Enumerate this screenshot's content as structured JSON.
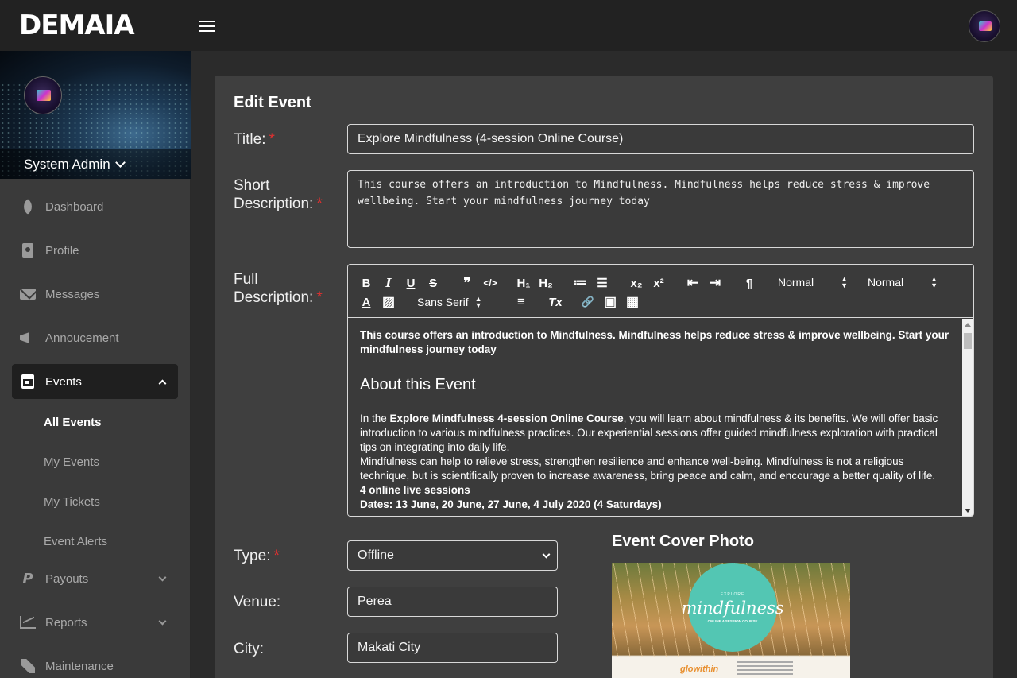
{
  "header": {
    "logo_text": "DEMAIA",
    "menu_icon": "hamburger-icon",
    "avatar_icon": "avatar"
  },
  "sidebar": {
    "user_name": "System Admin",
    "items": [
      {
        "label": "Dashboard",
        "icon": "rocket-icon"
      },
      {
        "label": "Profile",
        "icon": "id-badge-icon"
      },
      {
        "label": "Messages",
        "icon": "envelope-icon"
      },
      {
        "label": "Annoucement",
        "icon": "megaphone-icon"
      },
      {
        "label": "Events",
        "icon": "calendar-icon",
        "active": true
      },
      {
        "label": "Payouts",
        "icon": "paypal-icon"
      },
      {
        "label": "Reports",
        "icon": "chart-icon"
      },
      {
        "label": "Maintenance",
        "icon": "tools-icon"
      }
    ],
    "events_sub": [
      "All Events",
      "My Events",
      "My Tickets",
      "Event Alerts"
    ]
  },
  "form": {
    "heading": "Edit Event",
    "title_label": "Title:",
    "title_value": "Explore Mindfulness (4-session Online Course)",
    "short_desc_label_1": "Short",
    "short_desc_label_2": "Description:",
    "short_desc_value": "This course offers an introduction to Mindfulness. Mindfulness helps reduce stress & improve wellbeing. Start your mindfulness journey today",
    "full_desc_label_1": "Full",
    "full_desc_label_2": "Description:",
    "required_mark": "*",
    "type_label": "Type:",
    "type_value": "Offline",
    "venue_label": "Venue:",
    "venue_value": "Perea",
    "city_label": "City:",
    "city_value": "Makati City"
  },
  "editor": {
    "toolbar": {
      "bold": "B",
      "italic": "I",
      "underline": "U",
      "strike": "S",
      "quote": "❞",
      "code": "</>",
      "h1": "H₁",
      "h2": "H₂",
      "ordered_list": "≔",
      "bullet_list": "☰",
      "subscript": "x₂",
      "superscript": "x²",
      "outdent": "⇤",
      "indent": "⇥",
      "direction": "¶",
      "size_select": "Normal",
      "header_select": "Normal",
      "font_select": "Sans Serif",
      "color": "A",
      "background": "▨",
      "align": "≡",
      "clean": "Tx",
      "link": "🔗",
      "image": "▣",
      "video": "▦"
    },
    "content": {
      "intro": "This course offers an introduction to Mindfulness. Mindfulness helps reduce stress & improve wellbeing. Start your mindfulness journey today",
      "heading": "About this Event",
      "p1_prefix": "In the ",
      "p1_bold": "Explore Mindfulness 4-session Online Course",
      "p1_rest": ", you will learn about mindfulness & its benefits. We will offer basic introduction to various mindfulness practices. Our experiential sessions offer guided mindfulness exploration with practical tips on integrating into daily life.",
      "p2": "Mindfulness can help to relieve stress, strengthen resilience and enhance well-being. Mindfulness is not a religious technique, but is scientifically proven to increase awareness, bring peace and calm, and encourage a better quality of life.",
      "p3": "4 online live sessions",
      "p4": "Dates: 13 June, 20 June, 27 June, 4 July 2020 (4 Saturdays)"
    }
  },
  "cover": {
    "title": "Event Cover Photo",
    "small_top": "EXPLORE",
    "big_word": "mindfulness",
    "subtitle": "ONLINE 4-SESSION COURSE",
    "brand": "glowithin"
  }
}
